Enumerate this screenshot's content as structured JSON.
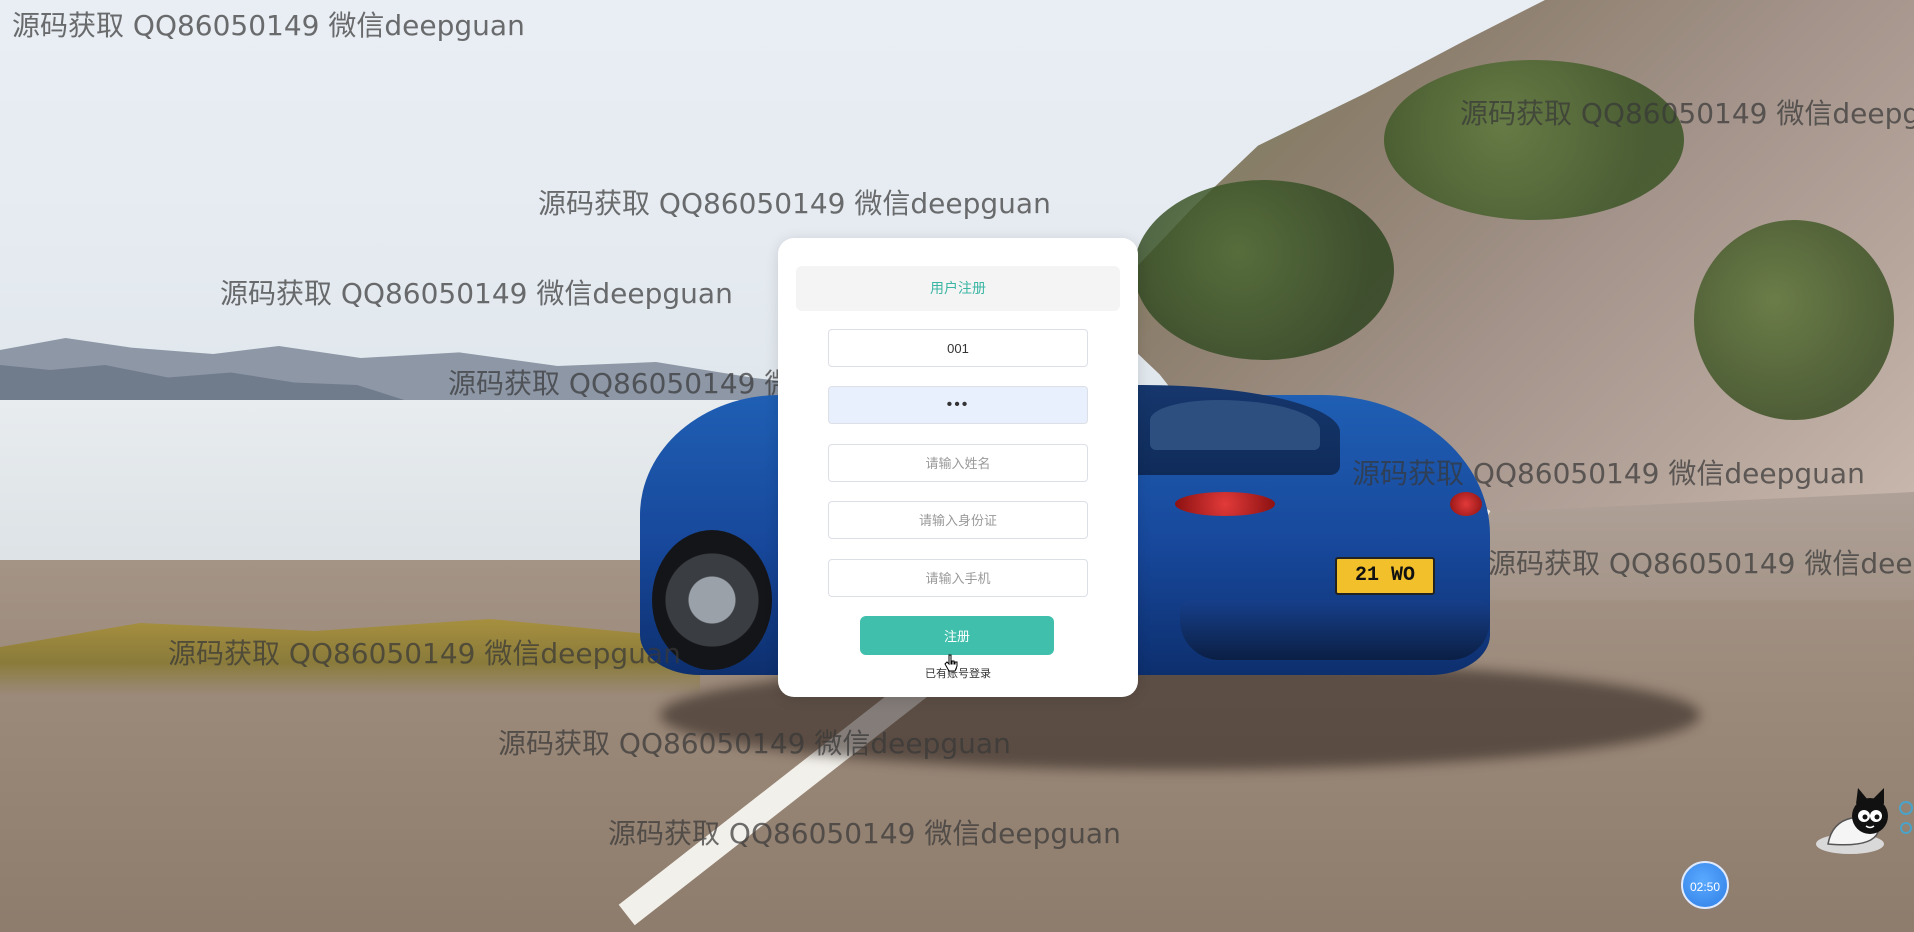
{
  "register_form": {
    "title": "用户注册",
    "fields": {
      "account": {
        "value": "001",
        "placeholder": ""
      },
      "password": {
        "value": "•••",
        "placeholder": ""
      },
      "name": {
        "value": "",
        "placeholder": "请输入姓名"
      },
      "id_card": {
        "value": "",
        "placeholder": "请输入身份证"
      },
      "phone": {
        "value": "",
        "placeholder": "请输入手机"
      }
    },
    "submit_label": "注册",
    "login_link": "已有账号登录"
  },
  "plate_text": "21 WO",
  "watermark": "源码获取 QQ86050149 微信deepguan",
  "timer_text": "02:50"
}
